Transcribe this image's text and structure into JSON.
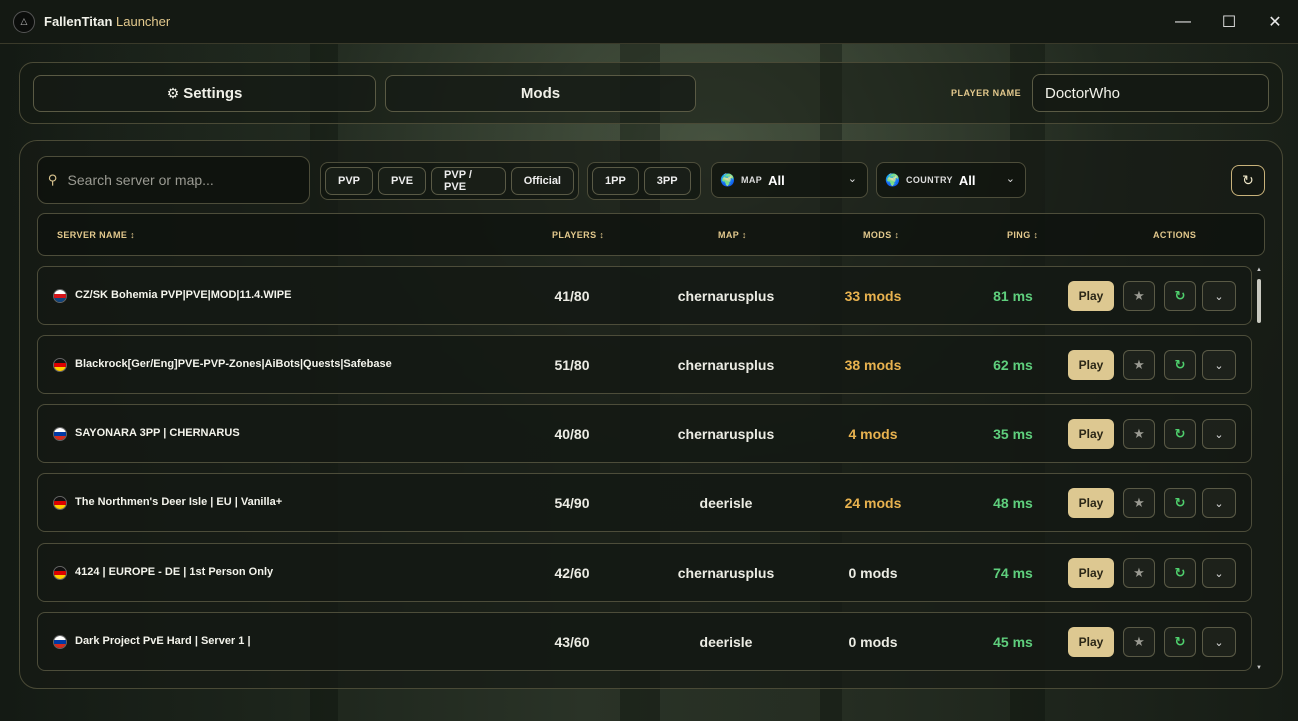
{
  "window": {
    "title": "FallenTitan",
    "title_sub": "Launcher",
    "controls": {
      "minimize": "—",
      "maximize": "☐",
      "close": "✕"
    }
  },
  "topbar": {
    "settings_label": "Settings",
    "mods_label": "Mods",
    "player_name_label": "PLAYER NAME",
    "player_name_value": "DoctorWho"
  },
  "filters": {
    "search_placeholder": "Search server or map...",
    "mode_chips": [
      "PVP",
      "PVE",
      "PVP / PVE",
      "Official"
    ],
    "view_chips": [
      "1PP",
      "3PP"
    ],
    "map_label": "MAP",
    "map_value": "All",
    "country_label": "COUNTRY",
    "country_value": "All"
  },
  "table": {
    "headers": {
      "server": "SERVER NAME ↕",
      "players": "PLAYERS ↕",
      "map": "MAP ↕",
      "mods": "MODS ↕",
      "ping": "PING ↕",
      "actions": "ACTIONS"
    },
    "play_label": "Play",
    "rows": [
      {
        "name": "CZ/SK Bohemia PVP|PVE|MOD|11.4.WIPE",
        "flag": "cz",
        "players": "41/80",
        "map": "chernarusplus",
        "mods": "33 mods",
        "ping": "81 ms"
      },
      {
        "name": "Blackrock[Ger/Eng]PVE-PVP-Zones|AiBots|Quests|Safebase",
        "flag": "de",
        "players": "51/80",
        "map": "chernarusplus",
        "mods": "38 mods",
        "ping": "62 ms"
      },
      {
        "name": "SAYONARA 3PP | CHERNARUS",
        "flag": "ru",
        "players": "40/80",
        "map": "chernarusplus",
        "mods": "4 mods",
        "ping": "35 ms"
      },
      {
        "name": "The Northmen's Deer Isle | EU | Vanilla+",
        "flag": "de",
        "players": "54/90",
        "map": "deerisle",
        "mods": "24 mods",
        "ping": "48 ms"
      },
      {
        "name": "4124 | EUROPE - DE | 1st Person Only",
        "flag": "de",
        "players": "42/60",
        "map": "chernarusplus",
        "mods": "0 mods",
        "ping": "74 ms"
      },
      {
        "name": "Dark Project PvE Hard | Server 1 |",
        "flag": "ru",
        "players": "43/60",
        "map": "deerisle",
        "mods": "0 mods",
        "ping": "45 ms"
      }
    ]
  },
  "colors": {
    "accent": "#e3c98d",
    "play_button": "#ddc891",
    "ping_good": "#5fcf7d",
    "mods_nonzero": "#e8b24f",
    "mods_zero": "#ececE4"
  },
  "icons": {
    "logo": "△",
    "gear": "⚙",
    "search": "⚲",
    "globe": "🌍",
    "chevron": "⌄",
    "refresh": "↻",
    "star": "★",
    "expand": "⌄",
    "scroll_up": "▲",
    "scroll_down": "▼"
  }
}
